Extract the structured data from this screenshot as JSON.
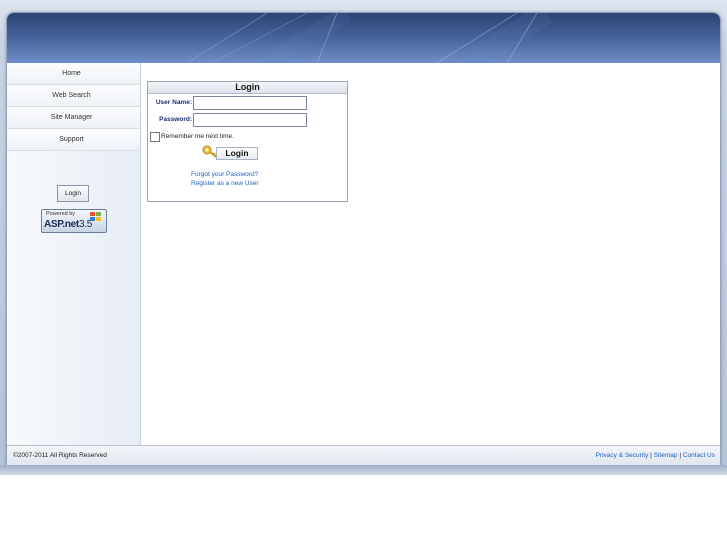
{
  "nav": {
    "items": [
      {
        "label": "Home"
      },
      {
        "label": "Web Search"
      },
      {
        "label": "Site Manager"
      },
      {
        "label": "Support"
      }
    ]
  },
  "sidebar": {
    "login_button": "Login",
    "badge": {
      "powered_by": "Powered by",
      "brand": "ASP.net",
      "version": "3.5"
    }
  },
  "login": {
    "title": "Login",
    "username_label": "User Name:",
    "username_value": "",
    "password_label": "Password:",
    "password_value": "",
    "remember_label": "Remember me next time.",
    "remember_checked": false,
    "button_label": "Login",
    "forgot_link": "Forgot your Password?",
    "register_link": "Register as a new User"
  },
  "footer": {
    "copyright": "©2007-2011 All Rights Reserved",
    "links": [
      "Privacy & Security",
      "Sitemap",
      "Contact Us"
    ],
    "separator": "|"
  },
  "colors": {
    "banner_top": "#2c4272",
    "banner_bottom": "#6f8fc8",
    "link": "#1f5fc4",
    "label": "#1b2f77"
  }
}
